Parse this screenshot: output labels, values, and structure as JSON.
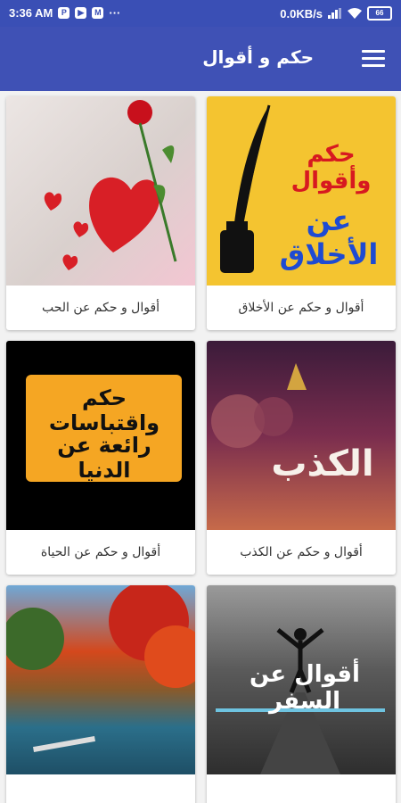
{
  "status_bar": {
    "time": "3:36 AM",
    "left_icons": [
      "P",
      "▶",
      "M",
      "···"
    ],
    "speed": "0.0KB/s",
    "battery": "66"
  },
  "app_bar": {
    "title": "حكم و أقوال",
    "menu_icon": "hamburger-menu-icon"
  },
  "cards": [
    {
      "caption": "أقوال و حكم عن الأخلاق",
      "image_text": [
        "حكم وأقوال",
        "عن الأخلاق"
      ]
    },
    {
      "caption": "أقوال و حكم عن الحب",
      "image_text": []
    },
    {
      "caption": "أقوال و حكم عن الكذب",
      "image_text": [
        "الكذب"
      ]
    },
    {
      "caption": "أقوال و حكم عن الحياة",
      "image_text": [
        "حكم واقتباسات",
        "رائعة عن الدنيا"
      ]
    },
    {
      "caption": "",
      "image_text": [
        "أقوال عن السفر"
      ]
    },
    {
      "caption": "",
      "image_text": []
    }
  ],
  "colors": {
    "primary": "#3f51b5",
    "status": "#3a4fb5",
    "background": "#f2f2f2"
  }
}
